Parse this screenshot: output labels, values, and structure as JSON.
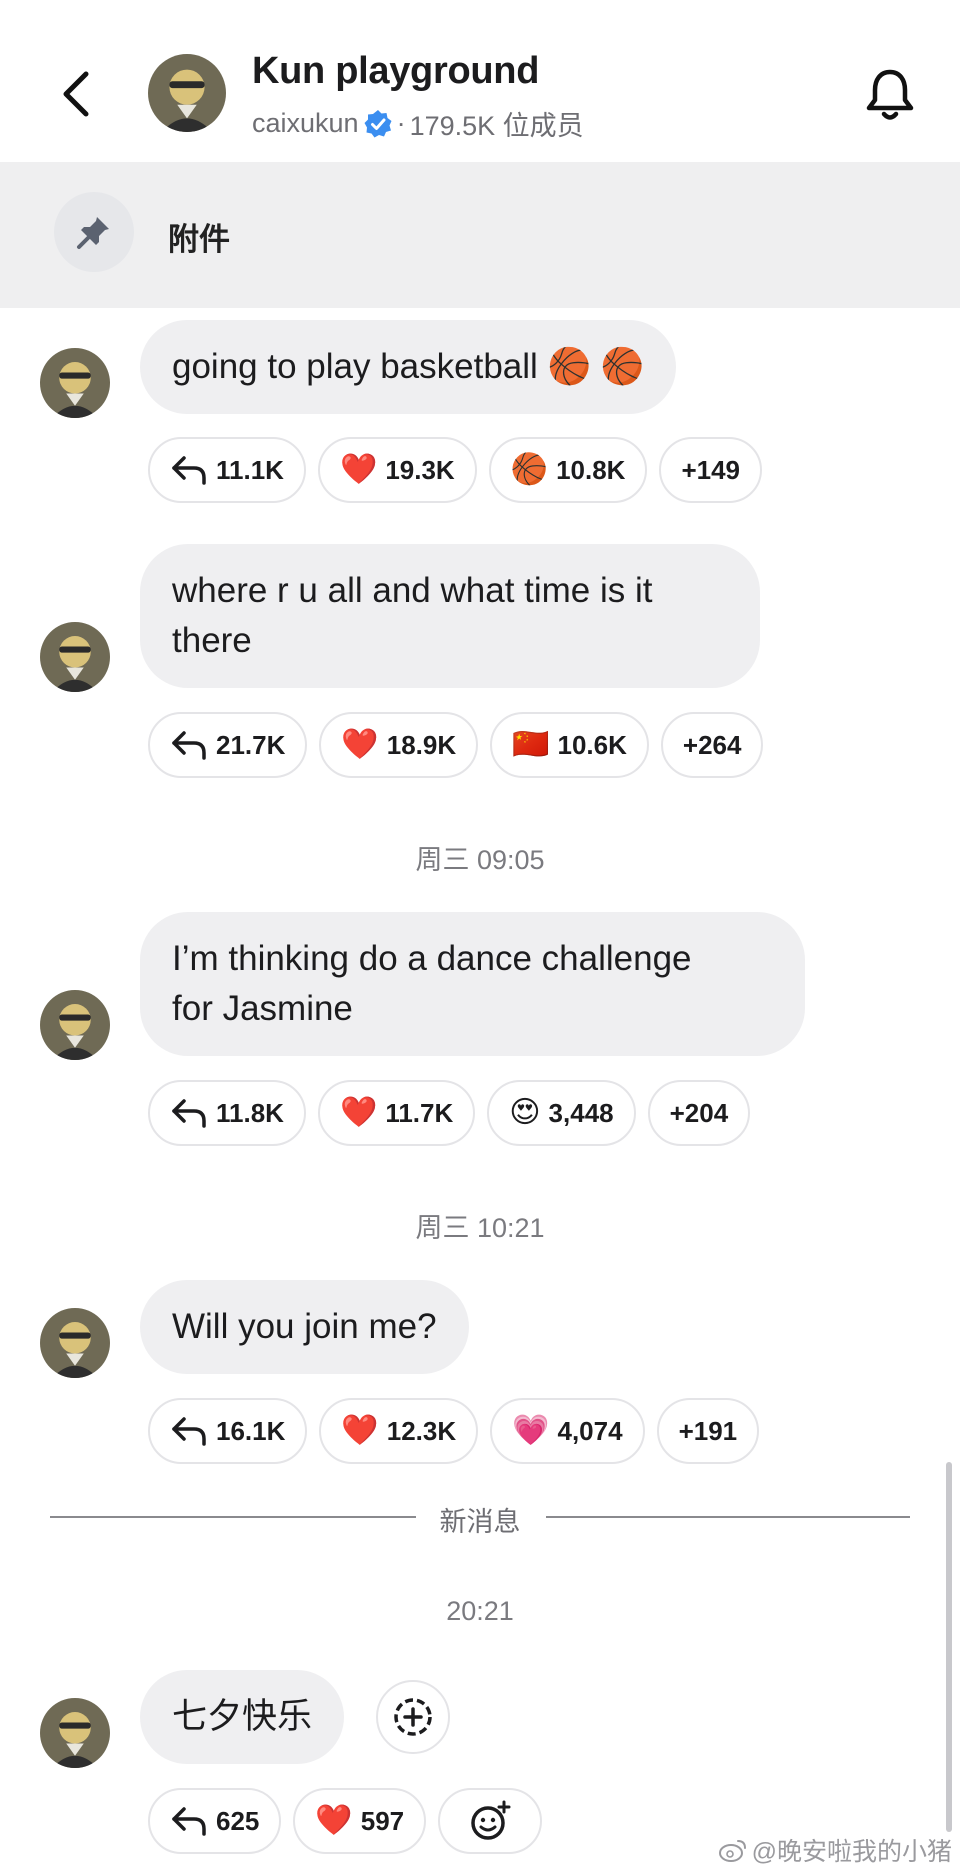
{
  "header": {
    "title": "Kun playground",
    "username": "caixukun",
    "separator": "·",
    "members": "179.5K 位成员",
    "back_icon": "chevron-left-icon",
    "bell_icon": "bell-icon"
  },
  "pinned": {
    "icon": "pin-icon",
    "label": "附件"
  },
  "messages": [
    {
      "text": "going to play basketball 🏀 🏀",
      "reactions": [
        {
          "icon": "reply-icon",
          "count": "11.1K"
        },
        {
          "emoji": "❤️",
          "count": "19.3K"
        },
        {
          "emoji": "🏀",
          "count": "10.8K"
        },
        {
          "count": "+149"
        }
      ]
    },
    {
      "text_line1": "where r u all and what time is it",
      "text_line2": "there",
      "reactions": [
        {
          "icon": "reply-icon",
          "count": "21.7K"
        },
        {
          "emoji": "❤️",
          "count": "18.9K"
        },
        {
          "emoji": "🇨🇳",
          "count": "10.6K"
        },
        {
          "count": "+264"
        }
      ]
    },
    {
      "timestamp": "周三 09:05",
      "text_line1": "I’m thinking do a dance challenge",
      "text_line2": "for Jasmine",
      "reactions": [
        {
          "icon": "reply-icon",
          "count": "11.8K"
        },
        {
          "emoji": "❤️",
          "count": "11.7K"
        },
        {
          "emoji": "😍",
          "count": "3,448"
        },
        {
          "count": "+204"
        }
      ]
    },
    {
      "timestamp": "周三 10:21",
      "text": "Will you join me?",
      "reactions": [
        {
          "icon": "reply-icon",
          "count": "16.1K"
        },
        {
          "emoji": "❤️",
          "count": "12.3K"
        },
        {
          "emoji": "💗",
          "count": "4,074"
        },
        {
          "count": "+191"
        }
      ]
    },
    {
      "timestamp": "20:21",
      "text": "七夕快乐",
      "reactions": [
        {
          "icon": "reply-icon",
          "count": "625"
        },
        {
          "emoji": "❤️",
          "count": "597"
        },
        {
          "icon": "add-reaction-icon"
        }
      ]
    }
  ],
  "new_messages_label": "新消息",
  "watermark": "@晚安啦我的小猪",
  "colors": {
    "bubble": "#efeff1",
    "pinned_bg": "#efeff0",
    "verified": "#3b8ef0",
    "text": "#1c1c1e",
    "muted": "#6e6e73"
  }
}
